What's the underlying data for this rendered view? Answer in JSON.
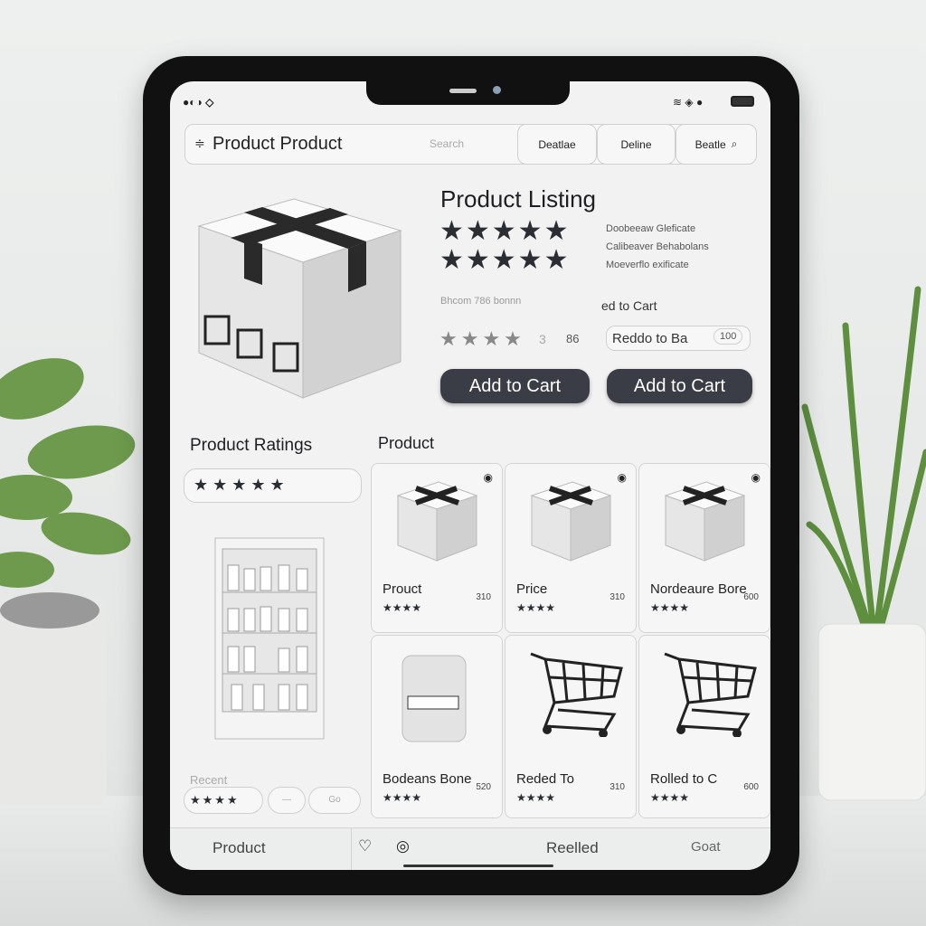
{
  "search": {
    "title": "Product Product",
    "placeholder": "Search",
    "filters": [
      "Deatlae",
      "Deline",
      "Beatle"
    ]
  },
  "listing": {
    "title": "Product Listing",
    "stars_row1": "★★★★★",
    "stars_row2": "★★★★★",
    "details": [
      "Doobeeaw Gleficate",
      "Calibeaver Behabolans",
      "Moeverflo exificate"
    ],
    "meta": "Bhcom 786 bonnn",
    "add_link": "ed to Cart",
    "rating_small": "★★★★",
    "rating_count": "3",
    "rating_extra": "86",
    "quantity_label": "Reddo to Ba",
    "quantity_value": "100",
    "buttons": [
      "Add to Cart",
      "Add to Cart"
    ]
  },
  "ratings": {
    "title": "Product Ratings",
    "stars": "★★★★★",
    "rating": 4.5
  },
  "grid": {
    "title": "Product",
    "items": [
      {
        "name": "Prouct",
        "stars": "★★★★",
        "price": "310"
      },
      {
        "name": "Price",
        "stars": "★★★★",
        "price": "310"
      },
      {
        "name": "Nordeaure Bore",
        "stars": "★★★★",
        "price": "600"
      },
      {
        "name": "Bodeans Bone",
        "stars": "★★★★",
        "price": "520"
      },
      {
        "name": "Reded To",
        "stars": "★★★★",
        "price": "310"
      },
      {
        "name": "Rolled to C",
        "stars": "★★★★",
        "price": "600"
      }
    ]
  },
  "recent": {
    "label": "Recent",
    "stars": "★★★★",
    "chip1": "—",
    "chip2": "Go"
  },
  "bottom_nav": {
    "items": [
      "Product",
      "Reelled",
      "Goat"
    ]
  }
}
